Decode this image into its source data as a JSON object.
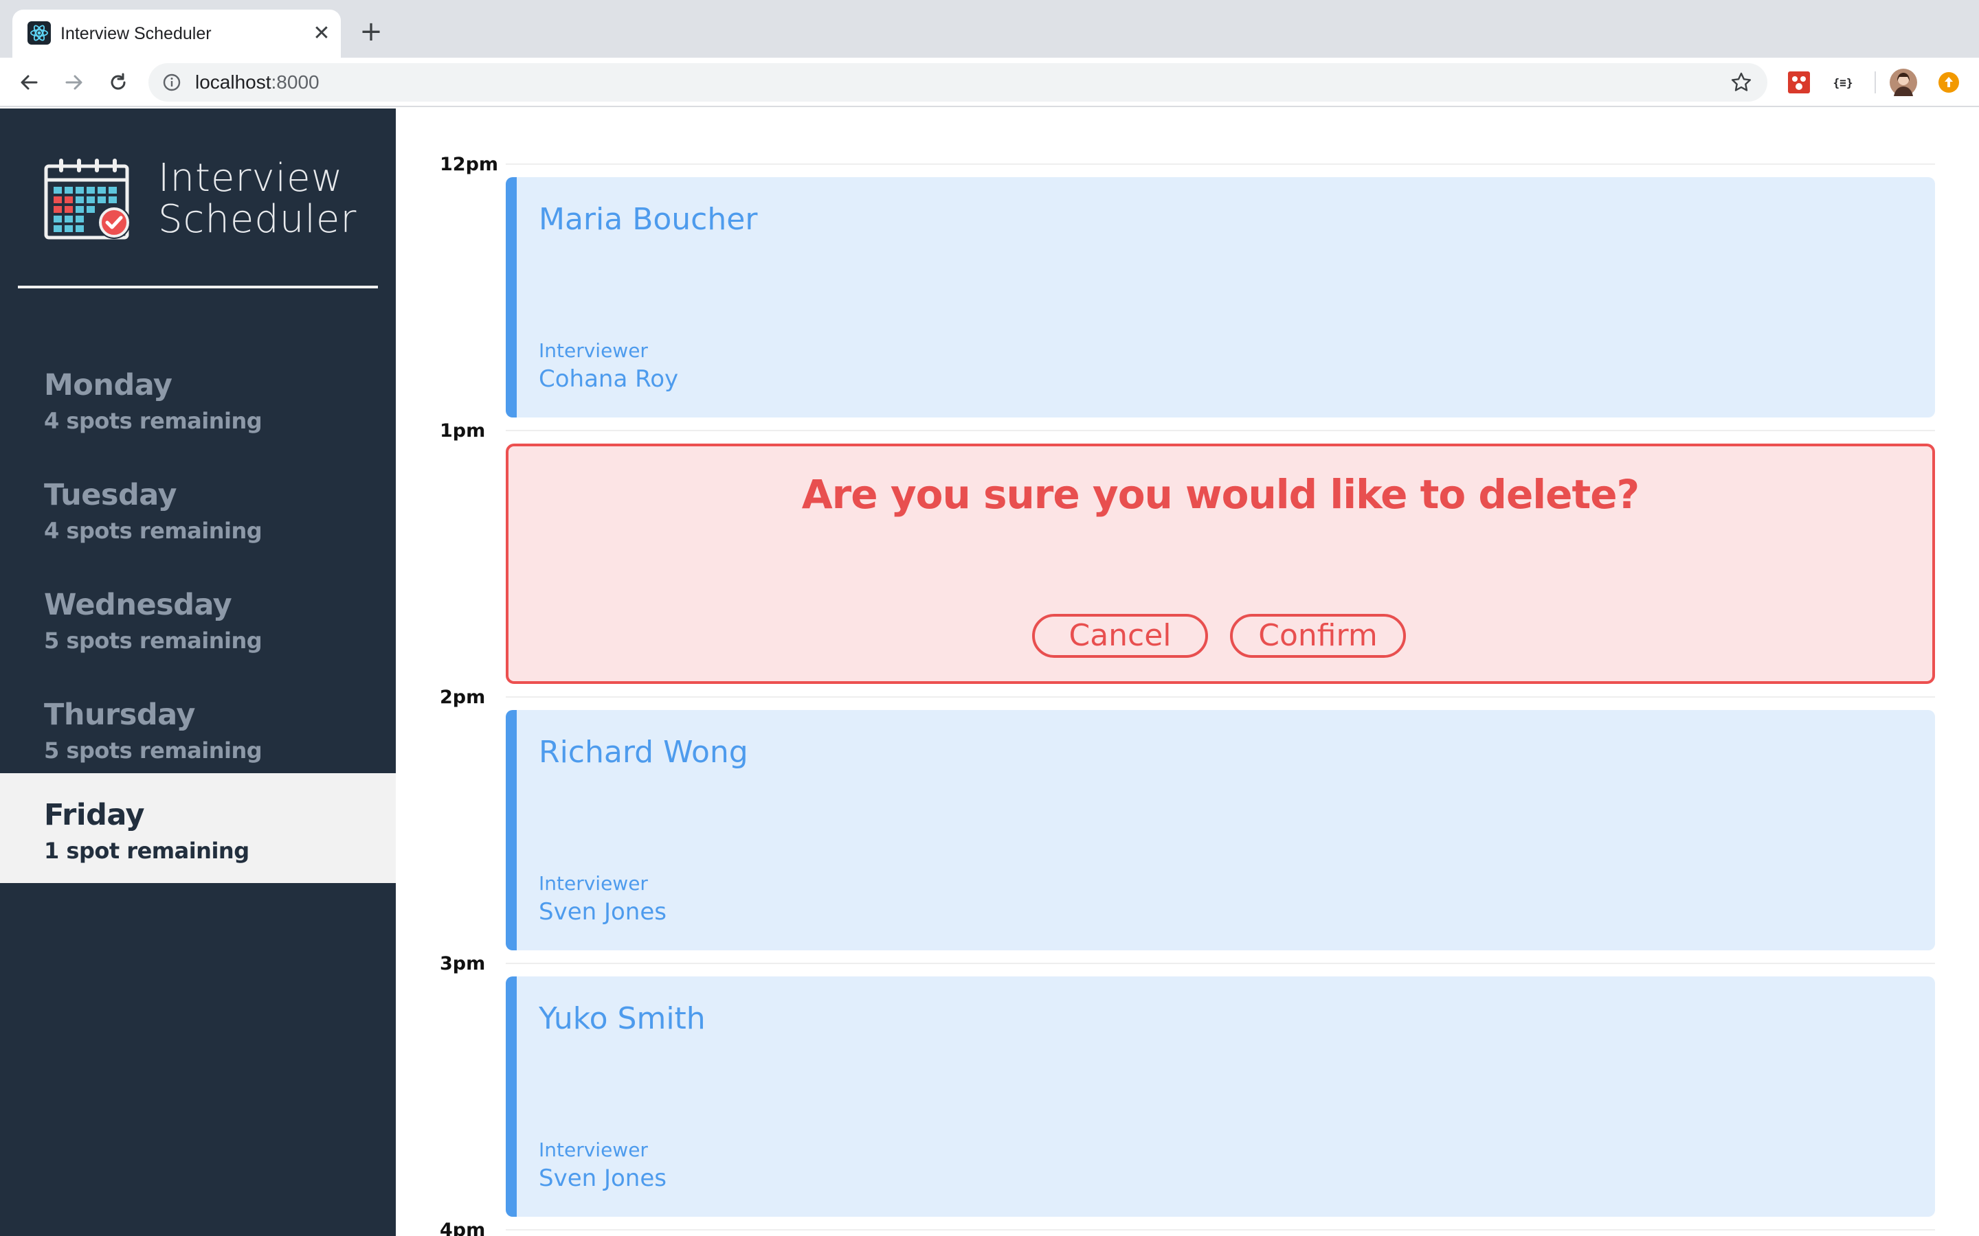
{
  "browser": {
    "tab_title": "Interview Scheduler",
    "tab_close": "✕",
    "new_tab": "+",
    "url_host": "localhost",
    "url_port": ":8000"
  },
  "sidebar": {
    "brand_line1": "Interview",
    "brand_line2": "Scheduler",
    "days": [
      {
        "name": "Monday",
        "spots": "4 spots remaining",
        "selected": false
      },
      {
        "name": "Tuesday",
        "spots": "4 spots remaining",
        "selected": false
      },
      {
        "name": "Wednesday",
        "spots": "5 spots remaining",
        "selected": false
      },
      {
        "name": "Thursday",
        "spots": "5 spots remaining",
        "selected": false
      },
      {
        "name": "Friday",
        "spots": "1 spot remaining",
        "selected": true
      }
    ]
  },
  "schedule": {
    "times": [
      "12pm",
      "1pm",
      "2pm",
      "3pm",
      "4pm"
    ],
    "appointments": [
      {
        "student": "Maria Boucher",
        "interviewer_label": "Interviewer",
        "interviewer": "Cohana Roy"
      },
      {
        "student": "Richard Wong",
        "interviewer_label": "Interviewer",
        "interviewer": "Sven Jones"
      },
      {
        "student": "Yuko Smith",
        "interviewer_label": "Interviewer",
        "interviewer": "Sven Jones"
      }
    ],
    "confirm": {
      "message": "Are you sure you would like to delete?",
      "cancel": "Cancel",
      "confirm": "Confirm"
    }
  },
  "colors": {
    "sidebar_bg": "#222f3e",
    "appointment_bg": "#e1eefc",
    "appointment_accent": "#4d9bed",
    "danger": "#e84f4f",
    "danger_bg": "#fce4e5"
  }
}
